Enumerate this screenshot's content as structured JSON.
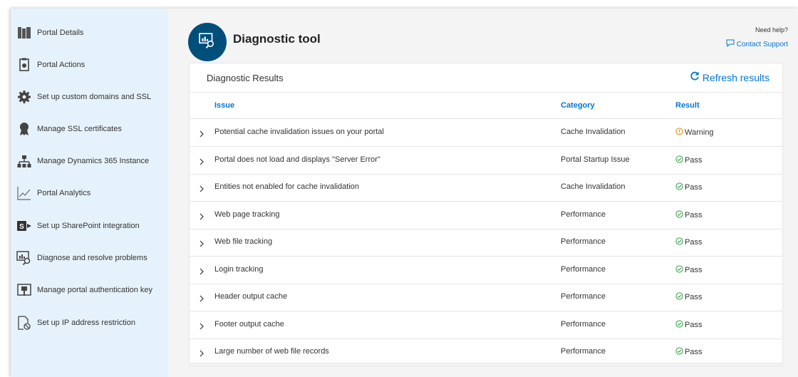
{
  "sidebar": {
    "items": [
      {
        "label": "Portal Details",
        "icon": "portal-details-icon"
      },
      {
        "label": "Portal Actions",
        "icon": "portal-actions-icon"
      },
      {
        "label": "Set up custom domains and SSL",
        "icon": "gear-icon"
      },
      {
        "label": "Manage SSL certificates",
        "icon": "certificate-icon"
      },
      {
        "label": "Manage Dynamics 365 Instance",
        "icon": "hierarchy-icon"
      },
      {
        "label": "Portal Analytics",
        "icon": "analytics-icon"
      },
      {
        "label": "Set up SharePoint integration",
        "icon": "sharepoint-icon"
      },
      {
        "label": "Diagnose and resolve problems",
        "icon": "diagnose-icon"
      },
      {
        "label": "Manage portal authentication key",
        "icon": "key-icon"
      },
      {
        "label": "Set up IP address restriction",
        "icon": "ip-restriction-icon"
      }
    ]
  },
  "header": {
    "title": "Diagnostic tool",
    "need_help": "Need help?",
    "contact_support": "Contact Support"
  },
  "panel": {
    "title": "Diagnostic Results",
    "refresh_label": "Refresh results",
    "columns": {
      "issue": "Issue",
      "category": "Category",
      "result": "Result"
    },
    "rows": [
      {
        "issue": "Potential cache invalidation issues on your portal",
        "category": "Cache Invalidation",
        "result": "Warning",
        "status": "warning"
      },
      {
        "issue": "Portal does not load and displays \"Server Error\"",
        "category": "Portal Startup Issue",
        "result": "Pass",
        "status": "pass"
      },
      {
        "issue": "Entities not enabled for cache invalidation",
        "category": "Cache Invalidation",
        "result": "Pass",
        "status": "pass"
      },
      {
        "issue": "Web page tracking",
        "category": "Performance",
        "result": "Pass",
        "status": "pass"
      },
      {
        "issue": "Web file tracking",
        "category": "Performance",
        "result": "Pass",
        "status": "pass"
      },
      {
        "issue": "Login tracking",
        "category": "Performance",
        "result": "Pass",
        "status": "pass"
      },
      {
        "issue": "Header output cache",
        "category": "Performance",
        "result": "Pass",
        "status": "pass"
      },
      {
        "issue": "Footer output cache",
        "category": "Performance",
        "result": "Pass",
        "status": "pass"
      },
      {
        "issue": "Large number of web file records",
        "category": "Performance",
        "result": "Pass",
        "status": "pass"
      }
    ]
  },
  "colors": {
    "accent": "#0078d4",
    "title_circle": "#004f7a",
    "sidebar_bg": "#e6f2fb",
    "pass": "#2ea043",
    "warning": "#e08a00"
  }
}
